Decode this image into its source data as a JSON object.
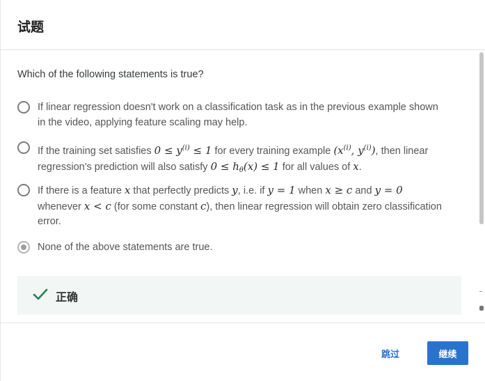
{
  "header": {
    "title": "试题"
  },
  "question": {
    "text": "Which of the following statements is true?"
  },
  "options": [
    {
      "selected": false,
      "line1": "If linear regression doesn't work on a classification task as in the previous example shown",
      "line2": "in the video, applying feature scaling may help."
    },
    {
      "selected": false,
      "t1": "If the training set satisfies ",
      "m1": "0 ≤ y",
      "m1_sup": "(i)",
      "m1b": " ≤ 1",
      "t2": " for every training example ",
      "m2a": "(x",
      "m2_sup1": "(i)",
      "m2b": ", y",
      "m2_sup2": "(i)",
      "m2c": ")",
      "t3": ", then linear",
      "t4": "regression's prediction will also satisfy ",
      "m3a": "0 ≤ h",
      "m3_sub": "θ",
      "m3b": "(x) ≤ 1",
      "t5": " for all values of ",
      "m4": "x",
      "t6": "."
    },
    {
      "selected": false,
      "t1": "If there is a feature ",
      "m1": "x",
      "t2": " that perfectly predicts ",
      "m2": "y",
      "t3": ", i.e. if ",
      "m3": "y = 1",
      "t4": " when ",
      "m4": "x ≥ c",
      "t5": " and ",
      "m5": "y = 0",
      "t6": "whenever ",
      "m6": "x < c",
      "t7": " (for some constant ",
      "m7": "c",
      "t8": "), then linear regression will obtain zero classification",
      "t9": "error."
    },
    {
      "selected": true,
      "line1": "None of the above statements are true."
    }
  ],
  "feedback": {
    "label": "正确",
    "icon": "checkmark-icon",
    "color": "#1f8354"
  },
  "footer": {
    "skip_label": "跳过",
    "continue_label": "继续"
  },
  "colors": {
    "accent": "#2a73cc",
    "feedback_bg": "#f2f7f5"
  }
}
